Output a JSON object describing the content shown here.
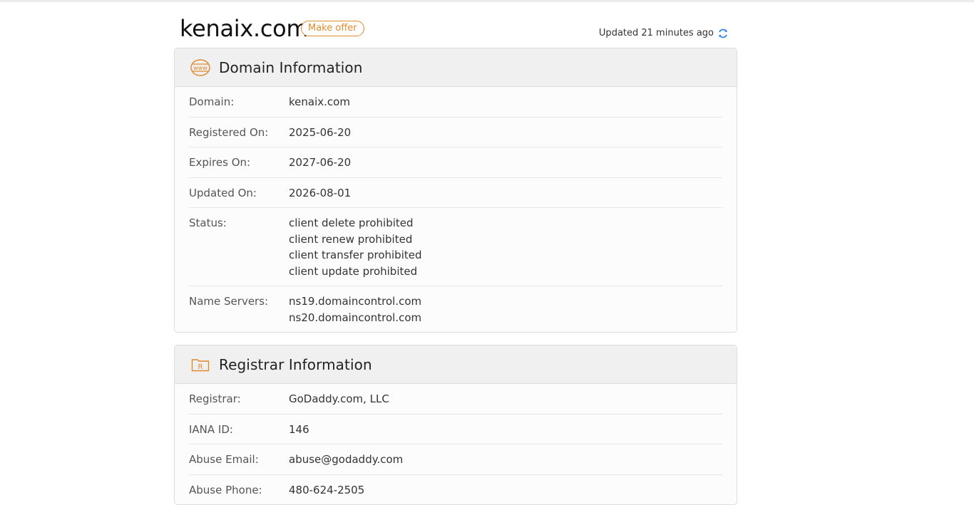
{
  "header": {
    "domain": "kenaix.com",
    "make_offer_label": "Make offer",
    "updated_text": "Updated 21 minutes ago"
  },
  "icons": {
    "domain_section": "www-globe-icon",
    "registrar_section": "registrar-folder-icon",
    "refresh": "refresh-icon"
  },
  "colors": {
    "accent_orange": "#e08a2e",
    "refresh_blue": "#3a8be0"
  },
  "domain_info": {
    "title": "Domain Information",
    "icon_text": "www",
    "rows": [
      {
        "label": "Domain:",
        "values": [
          "kenaix.com"
        ]
      },
      {
        "label": "Registered On:",
        "values": [
          "2025-06-20"
        ]
      },
      {
        "label": "Expires On:",
        "values": [
          "2027-06-20"
        ]
      },
      {
        "label": "Updated On:",
        "values": [
          "2026-08-01"
        ]
      },
      {
        "label": "Status:",
        "values": [
          "client delete prohibited",
          "client renew prohibited",
          "client transfer prohibited",
          "client update prohibited"
        ]
      },
      {
        "label": "Name Servers:",
        "values": [
          "ns19.domaincontrol.com",
          "ns20.domaincontrol.com"
        ]
      }
    ]
  },
  "registrar_info": {
    "title": "Registrar Information",
    "icon_text": "R",
    "rows": [
      {
        "label": "Registrar:",
        "values": [
          "GoDaddy.com, LLC"
        ]
      },
      {
        "label": "IANA ID:",
        "values": [
          "146"
        ]
      },
      {
        "label": "Abuse Email:",
        "values": [
          "abuse@godaddy.com"
        ]
      },
      {
        "label": "Abuse Phone:",
        "values": [
          "480-624-2505"
        ]
      }
    ]
  }
}
